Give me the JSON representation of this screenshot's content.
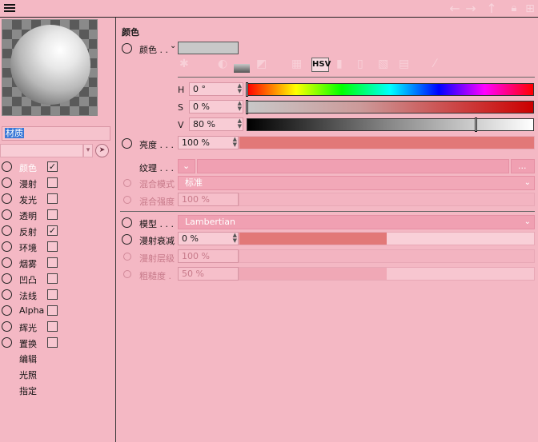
{
  "topbar": {
    "icons": [
      "menu-icon",
      "back-arrow-icon",
      "forward-arrow-icon",
      "up-arrow-icon",
      "lock-icon",
      "new-panel-icon"
    ]
  },
  "material": {
    "name": "材质"
  },
  "channels": [
    {
      "label": "颜色",
      "checked": true,
      "active": true
    },
    {
      "label": "漫射",
      "checked": false
    },
    {
      "label": "发光",
      "checked": false
    },
    {
      "label": "透明",
      "checked": false
    },
    {
      "label": "反射",
      "checked": true
    },
    {
      "label": "环境",
      "checked": false
    },
    {
      "label": "烟雾",
      "checked": false
    },
    {
      "label": "凹凸",
      "checked": false
    },
    {
      "label": "法线",
      "checked": false
    },
    {
      "label": "Alpha",
      "checked": false
    },
    {
      "label": "辉光",
      "checked": false
    },
    {
      "label": "置换",
      "checked": false
    }
  ],
  "extra_items": [
    "编辑",
    "光照",
    "指定"
  ],
  "check_mark": "✓",
  "color_section": {
    "title": "颜色",
    "color_label": "颜色 . .",
    "color_swatch": "#c8c8c8",
    "hsv_button": "HSV",
    "h_label": "H",
    "h_value": "0 °",
    "s_label": "S",
    "s_value": "0 %",
    "v_label": "V",
    "v_value": "80 %",
    "h_fraction": 0,
    "s_fraction": 0,
    "v_fraction": 0.8
  },
  "brightness": {
    "label": "亮度 . . .",
    "value": "100 %",
    "fraction": 1.0
  },
  "texture": {
    "label": "纹理 . . .",
    "button": "..."
  },
  "blend_mode": {
    "label": "混合模式",
    "value": "标准"
  },
  "blend_strength": {
    "label": "混合强度",
    "value": "100 %"
  },
  "model": {
    "label": "模型 . . .",
    "value": "Lambertian"
  },
  "diffuse_falloff": {
    "label": "漫射衰减",
    "value": "0 %",
    "fraction": 0.5
  },
  "diffuse_level": {
    "label": "漫射层级",
    "value": "100 %"
  },
  "roughness": {
    "label": "粗糙度 .",
    "value": "50 %",
    "fraction": 0.5
  },
  "colors": {
    "background": "#f4b8c4",
    "accent_bar": "#e27878",
    "selection": "#3a78d6"
  }
}
